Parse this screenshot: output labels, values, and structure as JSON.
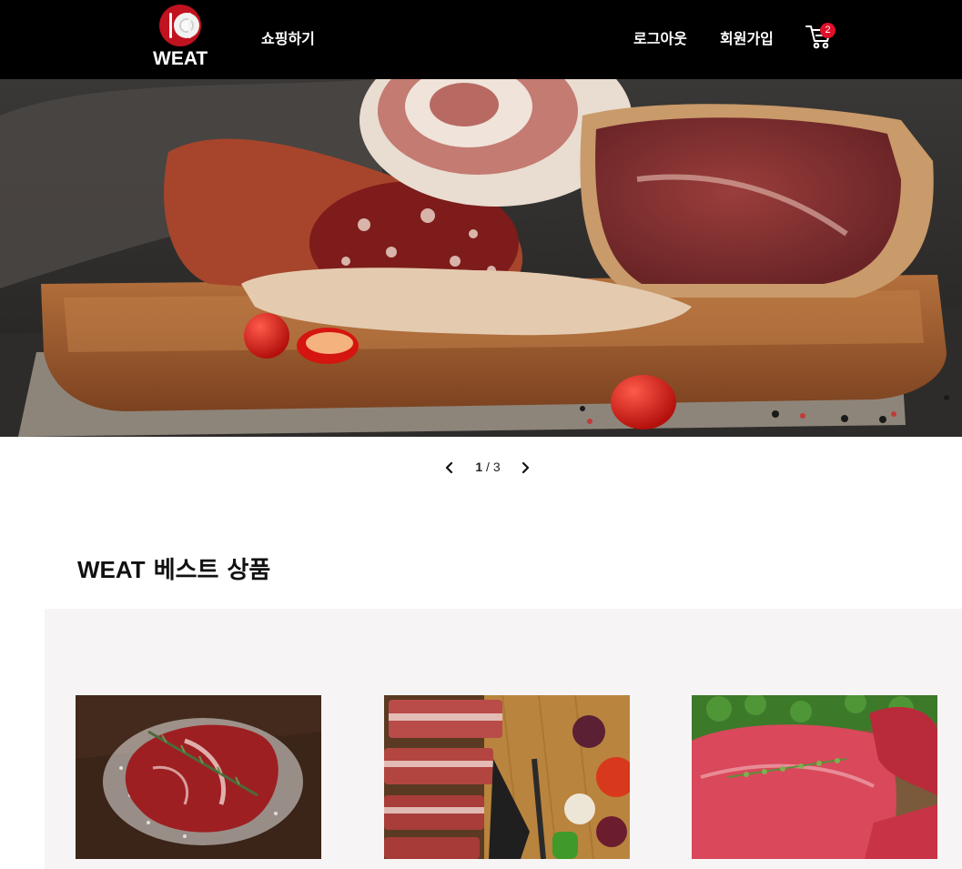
{
  "header": {
    "logo_text": "WEAT",
    "nav": {
      "shop_label": "쇼핑하기",
      "logout_label": "로그아웃",
      "signup_label": "회원가입"
    },
    "cart": {
      "icon": "cart-icon",
      "badge_count": "2"
    }
  },
  "hero": {
    "image": "cured-meats-on-cutting-board",
    "current_slide": "1",
    "separator": "/",
    "total_slides": "3",
    "prev_icon": "chevron-left-icon",
    "next_icon": "chevron-right-icon"
  },
  "best_products": {
    "title_latin": "WEAT",
    "title_korean": "베스트 상품",
    "products": [
      {
        "image": "ribeye-steak-with-rosemary-and-salt"
      },
      {
        "image": "beef-short-ribs-with-knife-and-vegetables"
      },
      {
        "image": "raw-beef-roast-with-thyme"
      }
    ]
  },
  "colors": {
    "header_bg": "#000000",
    "brand_red": "#c1121f",
    "badge_red": "#e0102b",
    "section_bg": "#f7f4f5"
  }
}
